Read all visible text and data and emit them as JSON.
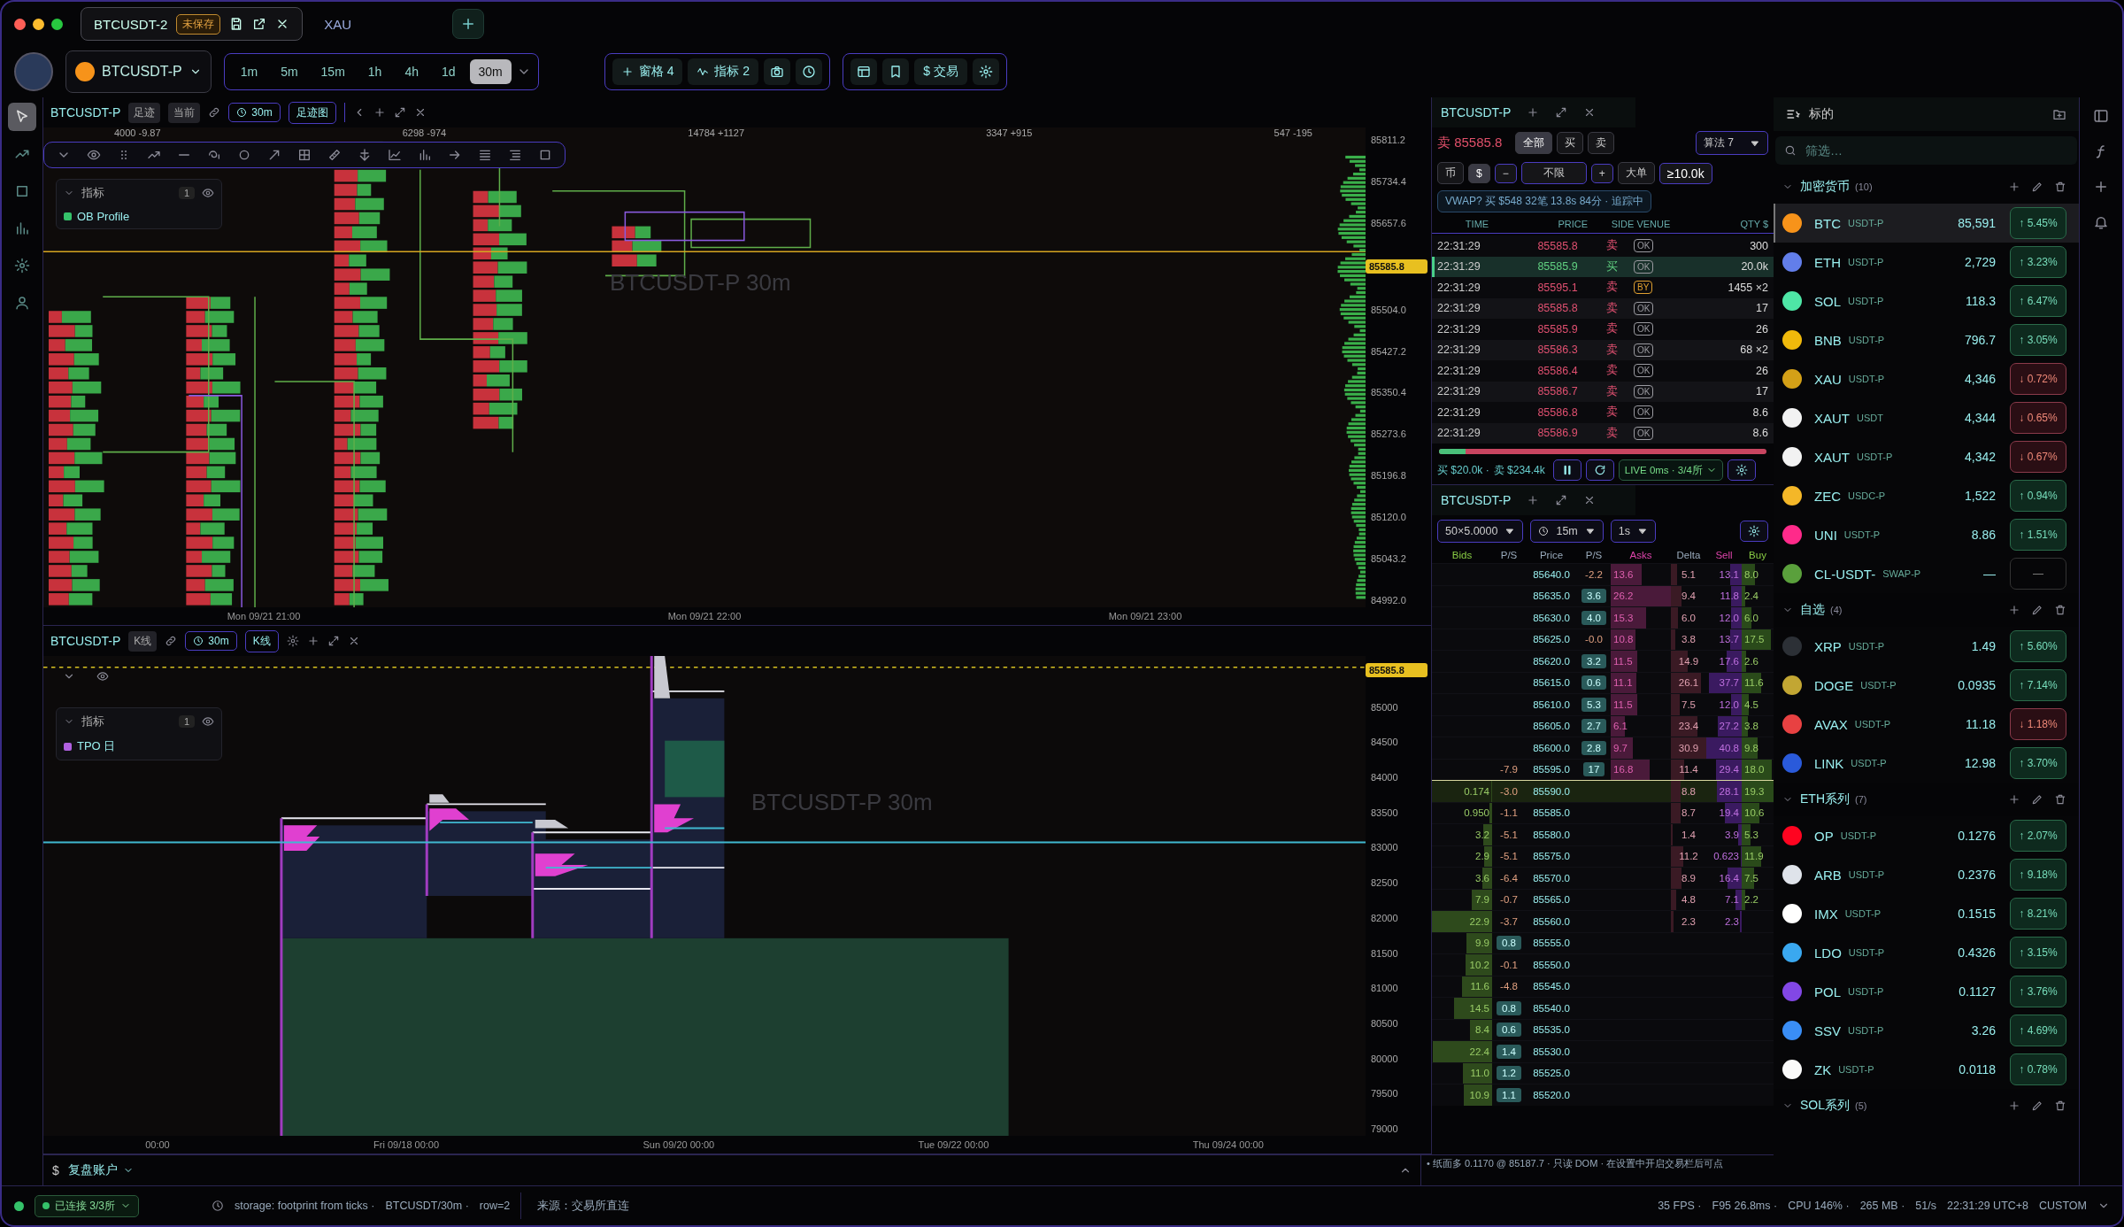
{
  "tabs": [
    {
      "label": "BTCUSDT-2",
      "badge": "未保存",
      "selected": true
    },
    {
      "label": "XAU",
      "selected": false
    }
  ],
  "toolbar": {
    "symbol": "BTCUSDT-P",
    "timeframes": [
      {
        "label": "1m",
        "selected": false
      },
      {
        "label": "5m",
        "selected": false
      },
      {
        "label": "15m",
        "selected": false
      },
      {
        "label": "1h",
        "selected": false
      },
      {
        "label": "4h",
        "selected": false
      },
      {
        "label": "1d",
        "selected": false
      },
      {
        "label": "30m",
        "selected": true
      }
    ],
    "panes": "窗格 4",
    "indicators": "指标 2",
    "trade": "$ 交易"
  },
  "upper_chart": {
    "symbol": "BTCUSDT-P",
    "tags": [
      "足迹",
      "当前"
    ],
    "interval": "30m",
    "type": "足迹图",
    "watermark": "BTCUSDT-P 30m",
    "column_stats": [
      "4000 -9.87",
      "6298 -974",
      "14784 +1127",
      "3347 +915",
      "547 -195"
    ],
    "legend": {
      "title": "指标",
      "count": "1",
      "items": [
        {
          "name": "OB Profile",
          "color": "#35c26a"
        }
      ]
    },
    "price_axis": [
      {
        "label": "85811.2",
        "kind": "tick"
      },
      {
        "label": "85734.4",
        "kind": "tick"
      },
      {
        "label": "85657.6",
        "kind": "tick"
      },
      {
        "label": "85585.8",
        "kind": "current"
      },
      {
        "label": "85504.0",
        "kind": "tick"
      },
      {
        "label": "85427.2",
        "kind": "tick"
      },
      {
        "label": "85350.4",
        "kind": "tick"
      },
      {
        "label": "85273.6",
        "kind": "tick"
      },
      {
        "label": "85196.8",
        "kind": "tick"
      },
      {
        "label": "85120.0",
        "kind": "tick"
      },
      {
        "label": "85043.2",
        "kind": "tick"
      },
      {
        "label": "84992.0",
        "kind": "tick"
      }
    ],
    "time_axis": [
      "Mon 09/21 21:00",
      "Mon 09/21 22:00",
      "Mon 09/21 23:00"
    ]
  },
  "lower_chart": {
    "symbol": "BTCUSDT-P",
    "tags": [
      "K线"
    ],
    "interval": "30m",
    "type": "K线",
    "watermark": "BTCUSDT-P 30m",
    "legend": {
      "title": "指标",
      "count": "1",
      "items": [
        {
          "name": "TPO 日",
          "color": "#b060e0"
        }
      ]
    },
    "price_axis": [
      {
        "label": "85585.8",
        "kind": "current"
      },
      {
        "label": "85000",
        "kind": "tick"
      },
      {
        "label": "84500",
        "kind": "tick"
      },
      {
        "label": "84000",
        "kind": "tick"
      },
      {
        "label": "83500",
        "kind": "tick"
      },
      {
        "label": "83000",
        "kind": "tick"
      },
      {
        "label": "82500",
        "kind": "tick"
      },
      {
        "label": "82000",
        "kind": "tick"
      },
      {
        "label": "81500",
        "kind": "tick"
      },
      {
        "label": "81000",
        "kind": "tick"
      },
      {
        "label": "80500",
        "kind": "tick"
      },
      {
        "label": "80000",
        "kind": "tick"
      },
      {
        "label": "79500",
        "kind": "tick"
      },
      {
        "label": "79000",
        "kind": "tick"
      }
    ],
    "time_axis": [
      "00:00",
      "Fri 09/18 00:00",
      "Sun 09/20 00:00",
      "Tue 09/22 00:00",
      "Thu 09/24 00:00"
    ]
  },
  "trades": {
    "symbol": "BTCUSDT-P",
    "last_side": "卖",
    "last_price": "85585.8",
    "side_filters": [
      {
        "label": "全部",
        "selected": true
      },
      {
        "label": "买",
        "selected": false
      },
      {
        "label": "卖",
        "selected": false
      }
    ],
    "algo": "算法 7",
    "units": [
      {
        "label": "币",
        "selected": false
      },
      {
        "label": "$",
        "selected": true
      }
    ],
    "minus": "−",
    "limit": "不限",
    "plus": "+",
    "big": "大单",
    "threshold": "≥10.0k",
    "vwap": "VWAP? 买 $548 32笔 13.8s 84分 · 追踪中",
    "columns": [
      "TIME",
      "PRICE",
      "SIDE VENUE",
      "QTY $"
    ],
    "rows": [
      {
        "time": "22:31:29",
        "price": "85585.8",
        "side": "卖",
        "kind": "sell",
        "venue": "OK",
        "color": "#9a9aa0",
        "qty": "300",
        "large": false
      },
      {
        "time": "22:31:29",
        "price": "85585.9",
        "side": "买",
        "kind": "buy",
        "venue": "OK",
        "color": "#9a9aa0",
        "qty": "20.0k",
        "large": true
      },
      {
        "time": "22:31:29",
        "price": "85595.1",
        "side": "卖",
        "kind": "sell",
        "venue": "BY",
        "color": "#e0a030",
        "qty": "1455 ×2",
        "large": false
      },
      {
        "time": "22:31:29",
        "price": "85585.8",
        "side": "卖",
        "kind": "sell",
        "venue": "OK",
        "color": "#9a9aa0",
        "qty": "17",
        "large": false
      },
      {
        "time": "22:31:29",
        "price": "85585.9",
        "side": "卖",
        "kind": "sell",
        "venue": "OK",
        "color": "#9a9aa0",
        "qty": "26",
        "large": false
      },
      {
        "time": "22:31:29",
        "price": "85586.3",
        "side": "卖",
        "kind": "sell",
        "venue": "OK",
        "color": "#9a9aa0",
        "qty": "68 ×2",
        "large": false
      },
      {
        "time": "22:31:29",
        "price": "85586.4",
        "side": "卖",
        "kind": "sell",
        "venue": "OK",
        "color": "#9a9aa0",
        "qty": "26",
        "large": false
      },
      {
        "time": "22:31:29",
        "price": "85586.7",
        "side": "卖",
        "kind": "sell",
        "venue": "OK",
        "color": "#9a9aa0",
        "qty": "17",
        "large": false
      },
      {
        "time": "22:31:29",
        "price": "85586.8",
        "side": "卖",
        "kind": "sell",
        "venue": "OK",
        "color": "#9a9aa0",
        "qty": "8.6",
        "large": false
      },
      {
        "time": "22:31:29",
        "price": "85586.9",
        "side": "卖",
        "kind": "sell",
        "venue": "OK",
        "color": "#9a9aa0",
        "qty": "8.6",
        "large": false
      }
    ],
    "buy_share": {
      "level": 0.08
    },
    "buy_total": "买 $20.0k ·",
    "sell_total": "卖 $234.4k",
    "live": "LIVE 0ms · 3/4所"
  },
  "dom": {
    "symbol": "BTCUSDT-P",
    "size": "50×5.0000",
    "interval": "15m",
    "refresh": "1s",
    "columns": [
      "Bids",
      "P/S",
      "Price",
      "P/S",
      "Asks",
      "Delta",
      "Sell",
      "Buy"
    ],
    "rows": [
      {
        "bid": "",
        "psl": "",
        "price": "85640.0",
        "psr": "-2.2",
        "ask": "13.6",
        "delta": "5.1",
        "sell": "13.1",
        "buy": "8.0",
        "current": false
      },
      {
        "bid": "",
        "psl": "",
        "price": "85635.0",
        "psr": "3.6",
        "ask": "26.2",
        "delta": "9.4",
        "sell": "11.8",
        "buy": "2.4",
        "current": false
      },
      {
        "bid": "",
        "psl": "",
        "price": "85630.0",
        "psr": "4.0",
        "ask": "15.3",
        "delta": "6.0",
        "sell": "12.0",
        "buy": "6.0",
        "current": false
      },
      {
        "bid": "",
        "psl": "",
        "price": "85625.0",
        "psr": "-0.0",
        "ask": "10.8",
        "delta": "3.8",
        "sell": "13.7",
        "buy": "17.5",
        "current": false
      },
      {
        "bid": "",
        "psl": "",
        "price": "85620.0",
        "psr": "3.2",
        "ask": "11.5",
        "delta": "14.9",
        "sell": "17.6",
        "buy": "2.6",
        "current": false
      },
      {
        "bid": "",
        "psl": "",
        "price": "85615.0",
        "psr": "0.6",
        "ask": "11.1",
        "delta": "26.1",
        "sell": "37.7",
        "buy": "11.6",
        "current": false
      },
      {
        "bid": "",
        "psl": "",
        "price": "85610.0",
        "psr": "5.3",
        "ask": "11.5",
        "delta": "7.5",
        "sell": "12.0",
        "buy": "4.5",
        "current": false
      },
      {
        "bid": "",
        "psl": "",
        "price": "85605.0",
        "psr": "2.7",
        "ask": "6.1",
        "delta": "23.4",
        "sell": "27.2",
        "buy": "3.8",
        "current": false
      },
      {
        "bid": "",
        "psl": "",
        "price": "85600.0",
        "psr": "2.8",
        "ask": "9.7",
        "delta": "30.9",
        "sell": "40.8",
        "buy": "9.8",
        "current": false
      },
      {
        "bid": "",
        "psl": "-7.9",
        "price": "85595.0",
        "psr": "17",
        "ask": "16.8",
        "delta": "11.4",
        "sell": "29.4",
        "buy": "18.0",
        "current": false
      },
      {
        "bid": "0.174",
        "psl": "-3.0",
        "price": "85590.0",
        "psr": "",
        "ask": "",
        "delta": "8.8",
        "sell": "28.1",
        "buy": "19.3",
        "current": true
      },
      {
        "bid": "0.950",
        "psl": "-1.1",
        "price": "85585.0",
        "psr": "",
        "ask": "",
        "delta": "8.7",
        "sell": "19.4",
        "buy": "10.6",
        "current": false
      },
      {
        "bid": "3.2",
        "psl": "-5.1",
        "price": "85580.0",
        "psr": "",
        "ask": "",
        "delta": "1.4",
        "sell": "3.9",
        "buy": "5.3",
        "current": false
      },
      {
        "bid": "2.9",
        "psl": "-5.1",
        "price": "85575.0",
        "psr": "",
        "ask": "",
        "delta": "11.2",
        "sell": "0.623",
        "buy": "11.9",
        "current": false
      },
      {
        "bid": "3.6",
        "psl": "-6.4",
        "price": "85570.0",
        "psr": "",
        "ask": "",
        "delta": "8.9",
        "sell": "16.4",
        "buy": "7.5",
        "current": false
      },
      {
        "bid": "7.9",
        "psl": "-0.7",
        "price": "85565.0",
        "psr": "",
        "ask": "",
        "delta": "4.8",
        "sell": "7.1",
        "buy": "2.2",
        "current": false
      },
      {
        "bid": "22.9",
        "psl": "-3.7",
        "price": "85560.0",
        "psr": "",
        "ask": "",
        "delta": "2.3",
        "sell": "2.3",
        "buy": "",
        "current": false
      },
      {
        "bid": "9.9",
        "psl": "0.8",
        "price": "85555.0",
        "psr": "",
        "ask": "",
        "delta": "",
        "sell": "",
        "buy": "",
        "current": false
      },
      {
        "bid": "10.2",
        "psl": "-0.1",
        "price": "85550.0",
        "psr": "",
        "ask": "",
        "delta": "",
        "sell": "",
        "buy": "",
        "current": false
      },
      {
        "bid": "11.6",
        "psl": "-4.8",
        "price": "85545.0",
        "psr": "",
        "ask": "",
        "delta": "",
        "sell": "",
        "buy": "",
        "current": false
      },
      {
        "bid": "14.5",
        "psl": "0.8",
        "price": "85540.0",
        "psr": "",
        "ask": "",
        "delta": "",
        "sell": "",
        "buy": "",
        "current": false
      },
      {
        "bid": "8.4",
        "psl": "0.6",
        "price": "85535.0",
        "psr": "",
        "ask": "",
        "delta": "",
        "sell": "",
        "buy": "",
        "current": false
      },
      {
        "bid": "22.4",
        "psl": "1.4",
        "price": "85530.0",
        "psr": "",
        "ask": "",
        "delta": "",
        "sell": "",
        "buy": "",
        "current": false
      },
      {
        "bid": "11.0",
        "psl": "1.2",
        "price": "85525.0",
        "psr": "",
        "ask": "",
        "delta": "",
        "sell": "",
        "buy": "",
        "current": false
      },
      {
        "bid": "10.9",
        "psl": "1.1",
        "price": "85520.0",
        "psr": "",
        "ask": "",
        "delta": "",
        "sell": "",
        "buy": "",
        "current": false
      }
    ],
    "footer": "• 纸面多 0.1170 @ 85187.7 · 只读 DOM · 在设置中开启交易栏后可点"
  },
  "sidebar": {
    "title": "标的",
    "filter_placeholder": "筛选…",
    "groups": [
      {
        "name": "加密货币",
        "count": "(10)",
        "expanded": true,
        "items": [
          {
            "symbol": "BTC",
            "quote": "USDT-P",
            "price": "85,591",
            "change": {
              "text": "↑ 5.45%",
              "kind": "gain"
            },
            "color": "#f7931a",
            "selected": true
          },
          {
            "symbol": "ETH",
            "quote": "USDT-P",
            "price": "2,729",
            "change": {
              "text": "↑ 3.23%",
              "kind": "gain"
            },
            "color": "#627eea",
            "selected": false
          },
          {
            "symbol": "SOL",
            "quote": "USDT-P",
            "price": "118.3",
            "change": {
              "text": "↑ 6.47%",
              "kind": "gain"
            },
            "color": "#4ee6a6",
            "selected": false
          },
          {
            "symbol": "BNB",
            "quote": "USDT-P",
            "price": "796.7",
            "change": {
              "text": "↑ 3.05%",
              "kind": "gain"
            },
            "color": "#f0b90b",
            "selected": false
          },
          {
            "symbol": "XAU",
            "quote": "USDT-P",
            "price": "4,346",
            "change": {
              "text": "↓ 0.72%",
              "kind": "loss"
            },
            "color": "#d4a017",
            "selected": false
          },
          {
            "symbol": "XAUT",
            "quote": "USDT",
            "price": "4,344",
            "change": {
              "text": "↓ 0.65%",
              "kind": "loss"
            },
            "color": "#f2f2f2",
            "selected": false
          },
          {
            "symbol": "XAUT",
            "quote": "USDT-P",
            "price": "4,342",
            "change": {
              "text": "↓ 0.67%",
              "kind": "loss"
            },
            "color": "#f2f2f2",
            "selected": false
          },
          {
            "symbol": "ZEC",
            "quote": "USDC-P",
            "price": "1,522",
            "change": {
              "text": "↑ 0.94%",
              "kind": "gain"
            },
            "color": "#f4b728",
            "selected": false
          },
          {
            "symbol": "UNI",
            "quote": "USDT-P",
            "price": "8.86",
            "change": {
              "text": "↑ 1.51%",
              "kind": "gain"
            },
            "color": "#ff2a8a",
            "selected": false
          },
          {
            "symbol": "CL-USDT-",
            "quote": "SWAP-P",
            "price": "—",
            "change": {
              "text": "—",
              "kind": "flat"
            },
            "color": "#5aa03c",
            "selected": false
          }
        ]
      },
      {
        "name": "自选",
        "count": "(4)",
        "expanded": true,
        "items": [
          {
            "symbol": "XRP",
            "quote": "USDT-P",
            "price": "1.49",
            "change": {
              "text": "↑ 5.60%",
              "kind": "gain"
            },
            "color": "#2c3036",
            "selected": false
          },
          {
            "symbol": "DOGE",
            "quote": "USDT-P",
            "price": "0.0935",
            "change": {
              "text": "↑ 7.14%",
              "kind": "gain"
            },
            "color": "#c2a633",
            "selected": false
          },
          {
            "symbol": "AVAX",
            "quote": "USDT-P",
            "price": "11.18",
            "change": {
              "text": "↓ 1.18%",
              "kind": "loss"
            },
            "color": "#e84142",
            "selected": false
          },
          {
            "symbol": "LINK",
            "quote": "USDT-P",
            "price": "12.98",
            "change": {
              "text": "↑ 3.70%",
              "kind": "gain"
            },
            "color": "#2a5ada",
            "selected": false
          }
        ]
      },
      {
        "name": "ETH系列",
        "count": "(7)",
        "expanded": true,
        "items": [
          {
            "symbol": "OP",
            "quote": "USDT-P",
            "price": "0.1276",
            "change": {
              "text": "↑ 2.07%",
              "kind": "gain"
            },
            "color": "#ff0420",
            "selected": false
          },
          {
            "symbol": "ARB",
            "quote": "USDT-P",
            "price": "0.2376",
            "change": {
              "text": "↑ 9.18%",
              "kind": "gain"
            },
            "color": "#dfe3ea",
            "selected": false
          },
          {
            "symbol": "IMX",
            "quote": "USDT-P",
            "price": "0.1515",
            "change": {
              "text": "↑ 8.21%",
              "kind": "gain"
            },
            "color": "#ffffff",
            "selected": false
          },
          {
            "symbol": "LDO",
            "quote": "USDT-P",
            "price": "0.4326",
            "change": {
              "text": "↑ 3.15%",
              "kind": "gain"
            },
            "color": "#3aa8f0",
            "selected": false
          },
          {
            "symbol": "POL",
            "quote": "USDT-P",
            "price": "0.1127",
            "change": {
              "text": "↑ 3.76%",
              "kind": "gain"
            },
            "color": "#8247e5",
            "selected": false
          },
          {
            "symbol": "SSV",
            "quote": "USDT-P",
            "price": "3.26",
            "change": {
              "text": "↑ 4.69%",
              "kind": "gain"
            },
            "color": "#3a8ef6",
            "selected": false
          },
          {
            "symbol": "ZK",
            "quote": "USDT-P",
            "price": "0.0118",
            "change": {
              "text": "↑ 0.78%",
              "kind": "gain"
            },
            "color": "#fafafa",
            "selected": false
          }
        ]
      },
      {
        "name": "SOL系列",
        "count": "(5)",
        "expanded": true
      }
    ]
  },
  "account": {
    "currency": "$",
    "name": "复盘账户"
  },
  "status_bar": {
    "connection": "已连接 3/3所",
    "storage": "storage: footprint from ticks ·",
    "series": "BTCUSDT/30m ·",
    "row": "row=2",
    "source": "来源：交易所直连",
    "metrics": [
      "35 FPS ·",
      "F95 26.8ms ·",
      "CPU 146% ·",
      "265 MB ·",
      "51/s",
      "22:31:29 UTC+8",
      "CUSTOM"
    ]
  }
}
